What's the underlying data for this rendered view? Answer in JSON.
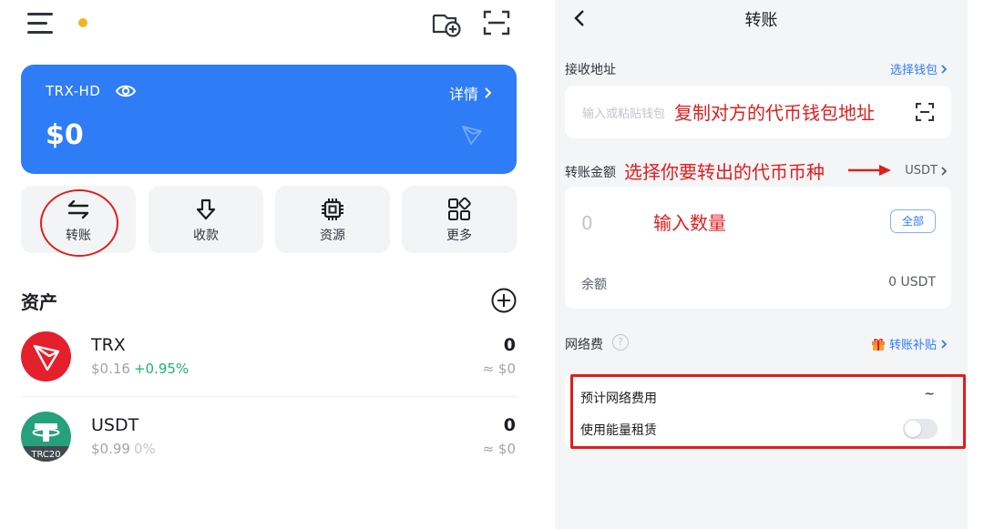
{
  "left": {
    "card": {
      "name": "TRX-HD",
      "detail_label": "详情",
      "balance": "$0"
    },
    "actions": [
      {
        "label": "转账"
      },
      {
        "label": "收款"
      },
      {
        "label": "资源"
      },
      {
        "label": "更多"
      }
    ],
    "assets_title": "资产",
    "assets": [
      {
        "symbol": "TRX",
        "price": "$0.16",
        "change": "+0.95%",
        "amount": "0",
        "value": "≈ $0"
      },
      {
        "symbol": "USDT",
        "price": "$0.99",
        "change": "0%",
        "amount": "0",
        "value": "≈ $0",
        "badge": "TRC20"
      }
    ],
    "colors": {
      "card": "#2e7cf6",
      "trx": "#e4202c",
      "usdt": "#26a17b",
      "up": "#1bb56a"
    }
  },
  "right": {
    "title": "转账",
    "receive_label": "接收地址",
    "select_wallet": "选择钱包",
    "address_placeholder": "输入或粘贴钱包",
    "address_annotation": "复制对方的代币钱包地址",
    "amount_label": "转账金额",
    "token_annotation": "选择你要转出的代币币种",
    "token": "USDT",
    "amount_value": "0",
    "quantity_annotation": "输入数量",
    "all_label": "全部",
    "balance_label": "余额",
    "balance_value": "0 USDT",
    "fee_label": "网络费",
    "subsidy_label": "转账补贴",
    "est_fee_label": "预计网络费用",
    "est_fee_value": "~",
    "energy_rent_label": "使用能量租赁",
    "energy_rent_enabled": false,
    "colors": {
      "link": "#2e7cf6",
      "annotation": "#e11d1d"
    }
  }
}
